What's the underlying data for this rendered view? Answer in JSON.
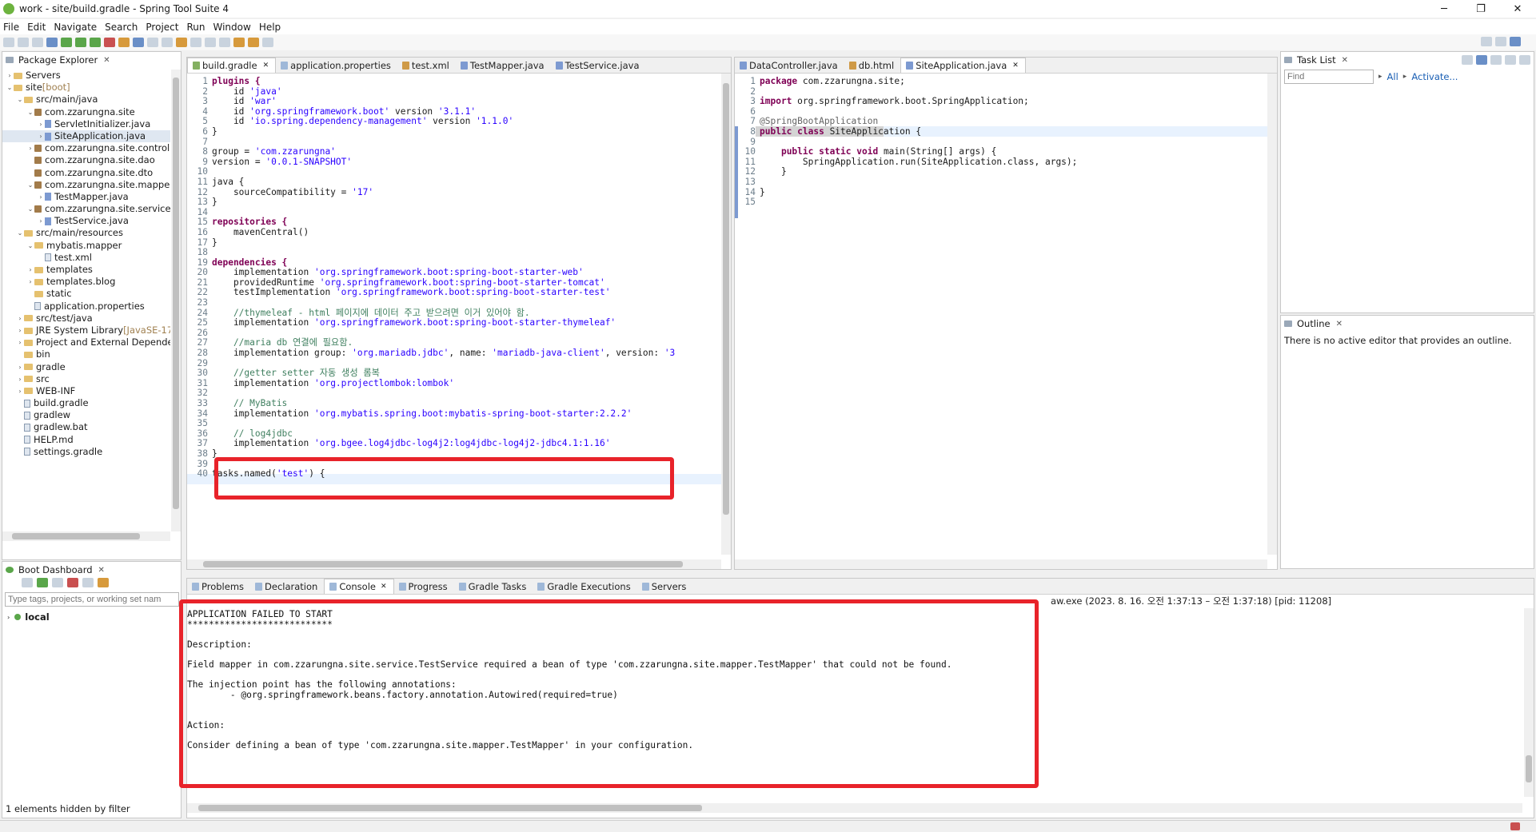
{
  "window": {
    "title": "work - site/build.gradle - Spring Tool Suite 4",
    "minimize": "─",
    "maximize": "❐",
    "close": "✕"
  },
  "menu": [
    "File",
    "Edit",
    "Navigate",
    "Search",
    "Project",
    "Run",
    "Window",
    "Help"
  ],
  "package_explorer": {
    "title": "Package Explorer",
    "items": [
      {
        "label": "Servers",
        "arrow": "›",
        "indent": 0,
        "icon": "folder"
      },
      {
        "label": "site",
        "suffix": " [boot]",
        "arrow": "⌄",
        "indent": 0,
        "icon": "folder"
      },
      {
        "label": "src/main/java",
        "arrow": "⌄",
        "indent": 1,
        "icon": "folder"
      },
      {
        "label": "com.zzarungna.site",
        "arrow": "⌄",
        "indent": 2,
        "icon": "package"
      },
      {
        "label": "ServletInitializer.java",
        "arrow": "›",
        "indent": 3,
        "icon": "java"
      },
      {
        "label": "SiteApplication.java",
        "arrow": "›",
        "indent": 3,
        "icon": "java",
        "selected": true
      },
      {
        "label": "com.zzarungna.site.controll",
        "arrow": "›",
        "indent": 2,
        "icon": "package"
      },
      {
        "label": "com.zzarungna.site.dao",
        "arrow": "",
        "indent": 2,
        "icon": "package"
      },
      {
        "label": "com.zzarungna.site.dto",
        "arrow": "",
        "indent": 2,
        "icon": "package"
      },
      {
        "label": "com.zzarungna.site.mapper",
        "arrow": "⌄",
        "indent": 2,
        "icon": "package"
      },
      {
        "label": "TestMapper.java",
        "arrow": "›",
        "indent": 3,
        "icon": "java"
      },
      {
        "label": "com.zzarungna.site.service",
        "arrow": "⌄",
        "indent": 2,
        "icon": "package"
      },
      {
        "label": "TestService.java",
        "arrow": "›",
        "indent": 3,
        "icon": "java"
      },
      {
        "label": "src/main/resources",
        "arrow": "⌄",
        "indent": 1,
        "icon": "folder"
      },
      {
        "label": "mybatis.mapper",
        "arrow": "⌄",
        "indent": 2,
        "icon": "folder"
      },
      {
        "label": "test.xml",
        "arrow": "",
        "indent": 3,
        "icon": "file"
      },
      {
        "label": "templates",
        "arrow": "›",
        "indent": 2,
        "icon": "folder"
      },
      {
        "label": "templates.blog",
        "arrow": "›",
        "indent": 2,
        "icon": "folder"
      },
      {
        "label": "static",
        "arrow": "",
        "indent": 2,
        "icon": "folder"
      },
      {
        "label": "application.properties",
        "arrow": "",
        "indent": 2,
        "icon": "file"
      },
      {
        "label": "src/test/java",
        "arrow": "›",
        "indent": 1,
        "icon": "folder"
      },
      {
        "label": "JRE System Library",
        "suffix": " [JavaSE-17",
        "arrow": "›",
        "indent": 1,
        "icon": "folder"
      },
      {
        "label": "Project and External Depende",
        "arrow": "›",
        "indent": 1,
        "icon": "folder"
      },
      {
        "label": "bin",
        "arrow": "",
        "indent": 1,
        "icon": "folder"
      },
      {
        "label": "gradle",
        "arrow": "›",
        "indent": 1,
        "icon": "folder"
      },
      {
        "label": "src",
        "arrow": "›",
        "indent": 1,
        "icon": "folder"
      },
      {
        "label": "WEB-INF",
        "arrow": "›",
        "indent": 1,
        "icon": "folder"
      },
      {
        "label": "build.gradle",
        "arrow": "",
        "indent": 1,
        "icon": "file"
      },
      {
        "label": "gradlew",
        "arrow": "",
        "indent": 1,
        "icon": "file"
      },
      {
        "label": "gradlew.bat",
        "arrow": "",
        "indent": 1,
        "icon": "file"
      },
      {
        "label": "HELP.md",
        "arrow": "",
        "indent": 1,
        "icon": "file"
      },
      {
        "label": "settings.gradle",
        "arrow": "",
        "indent": 1,
        "icon": "file"
      }
    ]
  },
  "boot_dashboard": {
    "title": "Boot Dashboard",
    "filter_placeholder": "Type tags, projects, or working set nam",
    "local": "local",
    "footer": "1 elements hidden by filter"
  },
  "editor_left": {
    "tabs": [
      "build.gradle",
      "application.properties",
      "test.xml",
      "TestMapper.java",
      "TestService.java"
    ],
    "lines": [
      [
        {
          "t": "plugins {",
          "c": "kw"
        }
      ],
      [
        {
          "t": "    id "
        },
        {
          "t": "'java'",
          "c": "str"
        }
      ],
      [
        {
          "t": "    id "
        },
        {
          "t": "'war'",
          "c": "str"
        }
      ],
      [
        {
          "t": "    id "
        },
        {
          "t": "'org.springframework.boot'",
          "c": "str"
        },
        {
          "t": " version "
        },
        {
          "t": "'3.1.1'",
          "c": "str"
        }
      ],
      [
        {
          "t": "    id "
        },
        {
          "t": "'io.spring.dependency-management'",
          "c": "str"
        },
        {
          "t": " version "
        },
        {
          "t": "'1.1.0'",
          "c": "str"
        }
      ],
      [
        {
          "t": "}"
        }
      ],
      [
        {
          "t": ""
        }
      ],
      [
        {
          "t": "group = "
        },
        {
          "t": "'com.zzarungna'",
          "c": "str"
        }
      ],
      [
        {
          "t": "version = "
        },
        {
          "t": "'0.0.1-SNAPSHOT'",
          "c": "str"
        }
      ],
      [
        {
          "t": ""
        }
      ],
      [
        {
          "t": "java {"
        }
      ],
      [
        {
          "t": "    sourceCompatibility = "
        },
        {
          "t": "'17'",
          "c": "str"
        }
      ],
      [
        {
          "t": "}"
        }
      ],
      [
        {
          "t": ""
        }
      ],
      [
        {
          "t": "repositories {",
          "c": "kw"
        }
      ],
      [
        {
          "t": "    mavenCentral()"
        }
      ],
      [
        {
          "t": "}"
        }
      ],
      [
        {
          "t": ""
        }
      ],
      [
        {
          "t": "dependencies {",
          "c": "kw"
        }
      ],
      [
        {
          "t": "    implementation "
        },
        {
          "t": "'org.springframework.boot:spring-boot-starter-web'",
          "c": "str"
        }
      ],
      [
        {
          "t": "    providedRuntime "
        },
        {
          "t": "'org.springframework.boot:spring-boot-starter-tomcat'",
          "c": "str"
        }
      ],
      [
        {
          "t": "    testImplementation "
        },
        {
          "t": "'org.springframework.boot:spring-boot-starter-test'",
          "c": "str"
        }
      ],
      [
        {
          "t": ""
        }
      ],
      [
        {
          "t": "    //thymeleaf - html 페이지에 데이터 주고 받으려면 이거 있어야 함.",
          "c": "cm"
        }
      ],
      [
        {
          "t": "    implementation "
        },
        {
          "t": "'org.springframework.boot:spring-boot-starter-thymeleaf'",
          "c": "str"
        }
      ],
      [
        {
          "t": ""
        }
      ],
      [
        {
          "t": "    //maria db 연결에 필요함.",
          "c": "cm"
        }
      ],
      [
        {
          "t": "    implementation group: "
        },
        {
          "t": "'org.mariadb.jdbc'",
          "c": "str"
        },
        {
          "t": ", name: "
        },
        {
          "t": "'mariadb-java-client'",
          "c": "str"
        },
        {
          "t": ", version: "
        },
        {
          "t": "'3",
          "c": "str"
        }
      ],
      [
        {
          "t": ""
        }
      ],
      [
        {
          "t": "    //getter setter 자동 생성 롬복",
          "c": "cm"
        }
      ],
      [
        {
          "t": "    implementation "
        },
        {
          "t": "'org.projectlombok:lombok'",
          "c": "str"
        }
      ],
      [
        {
          "t": ""
        }
      ],
      [
        {
          "t": "    // MyBatis",
          "c": "cm"
        }
      ],
      [
        {
          "t": "    implementation "
        },
        {
          "t": "'org.mybatis.spring.boot:mybatis-spring-boot-starter:2.2.2'",
          "c": "str"
        }
      ],
      [
        {
          "t": ""
        }
      ],
      [
        {
          "t": "    // log4jdbc",
          "c": "cm"
        }
      ],
      [
        {
          "t": "    implementation "
        },
        {
          "t": "'org.bgee.log4jdbc-log4j2:log4jdbc-log4j2-jdbc4.1:1.16'",
          "c": "str"
        }
      ],
      [
        {
          "t": "}"
        }
      ],
      [
        {
          "t": ""
        }
      ],
      [
        {
          "t": "tasks.named("
        },
        {
          "t": "'test'",
          "c": "str"
        },
        {
          "t": ") {"
        }
      ]
    ]
  },
  "editor_right": {
    "tabs": [
      "DataController.java",
      "db.html",
      "SiteApplication.java"
    ],
    "lines": [
      [
        {
          "t": "package ",
          "c": "kw"
        },
        {
          "t": "com.zzarungna.site;"
        }
      ],
      [
        {
          "t": ""
        }
      ],
      [
        {
          "t": "import ",
          "c": "kw"
        },
        {
          "t": "org.springframework.boot.SpringApplication;"
        }
      ],
      [
        {
          "t": ""
        }
      ],
      [
        {
          "t": ""
        }
      ],
      [
        {
          "t": ""
        }
      ],
      [
        {
          "t": "@SpringBootApplication",
          "c": "ann"
        }
      ],
      [
        {
          "t": "public class ",
          "c": "kw"
        },
        {
          "t": "SiteApplication {"
        }
      ],
      [
        {
          "t": ""
        }
      ],
      [
        {
          "t": "    "
        },
        {
          "t": "public static void ",
          "c": "kw"
        },
        {
          "t": "main(String[] args) {"
        }
      ],
      [
        {
          "t": "        SpringApplication.run(SiteApplication.class, args);"
        }
      ],
      [
        {
          "t": "    }"
        }
      ],
      [
        {
          "t": ""
        }
      ],
      [
        {
          "t": "}"
        }
      ],
      [
        {
          "t": ""
        }
      ]
    ],
    "line_numbers": [
      "1",
      "2",
      "3",
      "6",
      "7",
      "8",
      "9",
      "10",
      "11",
      "12",
      "13",
      "14",
      "15"
    ]
  },
  "task_list": {
    "title": "Task List",
    "find_placeholder": "Find",
    "all": "All",
    "activate": "Activate..."
  },
  "outline": {
    "title": "Outline",
    "message": "There is no active editor that provides an outline."
  },
  "bottom_tabs": [
    "Problems",
    "Declaration",
    "Console",
    "Progress",
    "Gradle Tasks",
    "Gradle Executions",
    "Servers"
  ],
  "console": {
    "header": "aw.exe  (2023. 8. 16. 오전 1:37:13 – 오전 1:37:18) [pid: 11208]",
    "lines": [
      "APPLICATION FAILED TO START",
      "***************************",
      "",
      "Description:",
      "",
      "Field mapper in com.zzarungna.site.service.TestService required a bean of type 'com.zzarungna.site.mapper.TestMapper' that could not be found.",
      "",
      "The injection point has the following annotations:",
      "        - @org.springframework.beans.factory.annotation.Autowired(required=true)",
      "",
      "",
      "Action:",
      "",
      "Consider defining a bean of type 'com.zzarungna.site.mapper.TestMapper' in your configuration."
    ]
  },
  "colors": {
    "highlight": "#e8232a",
    "keyword": "#7f0055",
    "string": "#2a00ff",
    "comment": "#3f7f5f"
  }
}
